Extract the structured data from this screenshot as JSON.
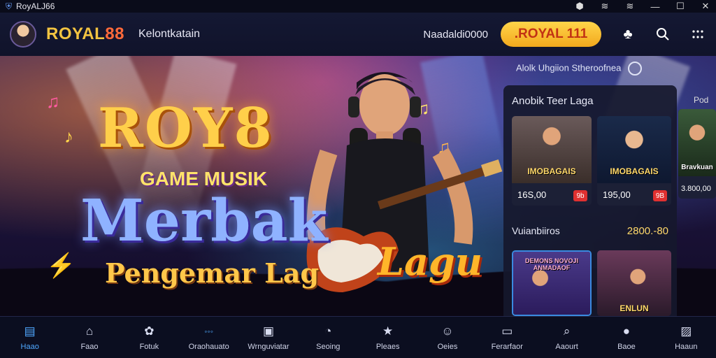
{
  "statusbar": {
    "app_name": "RoyALJ66",
    "icons": [
      "shield-icon",
      "wifi-icon",
      "wifi-icon",
      "minimize-icon",
      "maximize-icon",
      "close-icon"
    ]
  },
  "header": {
    "brand_main": "ROYAL",
    "brand_num": "88",
    "nav_label": "Kelontkatain",
    "balance": "Naadaldi0000",
    "cta_label": ".ROYAL 111",
    "icons": [
      "clover-icon",
      "search-icon",
      "grid-icon"
    ]
  },
  "hero": {
    "title_1": "ROY8",
    "title_2": "GAME MUSIK",
    "title_3": "Merbak",
    "title_4": "Pengemar Lag",
    "title_5": "Lagu"
  },
  "panel": {
    "header": "Alolk Uhgiion Stheroofnea",
    "title": "Anobik Teer Laga",
    "cards": [
      {
        "name": "IMOBAGAIS",
        "price": "16S,00",
        "tag": "9b"
      },
      {
        "name": "IMOBAGAIS",
        "price": "195,00",
        "tag": "9B"
      }
    ],
    "row2_label": "Vuianbiiros",
    "row2_amount": "2800.-80",
    "bottom_cards": [
      {
        "name": "DEMONS NOVOJI ANMADAOF"
      },
      {
        "name": "ENLUN"
      }
    ]
  },
  "sidecol": {
    "title": "Pod",
    "card_name": "Bravkuan",
    "card_price": "3.800,00"
  },
  "tabs": [
    {
      "label": "Haao",
      "icon": "list-icon",
      "active": true
    },
    {
      "label": "Faao",
      "icon": "home-icon",
      "active": false
    },
    {
      "label": "Fotuk",
      "icon": "gamepad-icon",
      "active": false
    },
    {
      "label": "Oraohauato",
      "icon": "code-icon",
      "active": false
    },
    {
      "label": "Wrnguviatar",
      "icon": "image-icon",
      "active": false
    },
    {
      "label": "Seoing",
      "icon": "compass-icon",
      "active": false
    },
    {
      "label": "Pleaes",
      "icon": "star-icon",
      "active": false
    },
    {
      "label": "Oeies",
      "icon": "people-icon",
      "active": false
    },
    {
      "label": "Ferarfaor",
      "icon": "document-icon",
      "active": false
    },
    {
      "label": "Aaourt",
      "icon": "search-icon",
      "active": false
    },
    {
      "label": "Baoe",
      "icon": "user-icon",
      "active": false
    },
    {
      "label": "Haaun",
      "icon": "chart-icon",
      "active": false
    }
  ],
  "colors": {
    "accent": "#4fa8ff",
    "gold": "#ffcf4a",
    "cta_bg": "#f2a81d",
    "background": "#0d1024"
  }
}
